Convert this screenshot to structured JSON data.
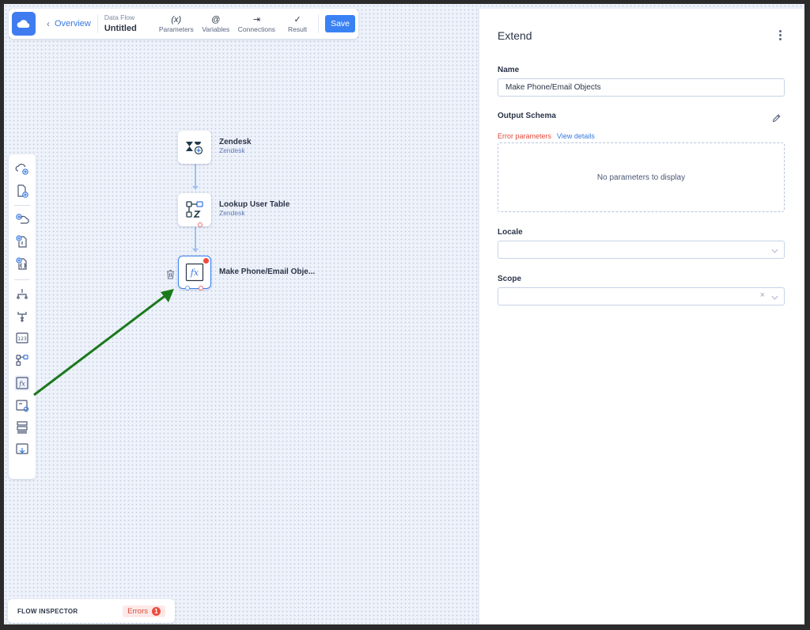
{
  "toolbar": {
    "back_label": "Overview",
    "breadcrumb_small": "Data Flow",
    "breadcrumb_title": "Untitled",
    "tools": [
      {
        "icon": "(x)",
        "label": "Parameters"
      },
      {
        "icon": "@",
        "label": "Variables"
      },
      {
        "icon": "⇥",
        "label": "Connections"
      },
      {
        "icon": "✓",
        "label": "Result"
      }
    ],
    "save_label": "Save"
  },
  "nodes": [
    {
      "title": "Zendesk",
      "subtitle": "Zendesk",
      "icon": "zendesk-add-icon"
    },
    {
      "title": "Lookup User Table",
      "subtitle": "Zendesk",
      "icon": "lookup-table-icon"
    },
    {
      "title": "Make Phone/Email Obje...",
      "subtitle": "",
      "icon": "fx-icon",
      "has_error": true
    }
  ],
  "inspector": {
    "label": "FLOW INSPECTOR",
    "errors_label": "Errors",
    "errors_count": "1"
  },
  "panel": {
    "title": "Extend",
    "name_label": "Name",
    "name_value": "Make Phone/Email Objects",
    "output_schema_label": "Output Schema",
    "error_parameters": "Error parameters",
    "view_details": "View details",
    "no_params": "No parameters to display",
    "locale_label": "Locale",
    "locale_value": "",
    "scope_label": "Scope",
    "scope_value": ""
  },
  "colors": {
    "accent": "#3a82f4",
    "error": "#e2493b",
    "annotation_arrow": "#1a7a1a",
    "canvas": "#eef2fb"
  }
}
